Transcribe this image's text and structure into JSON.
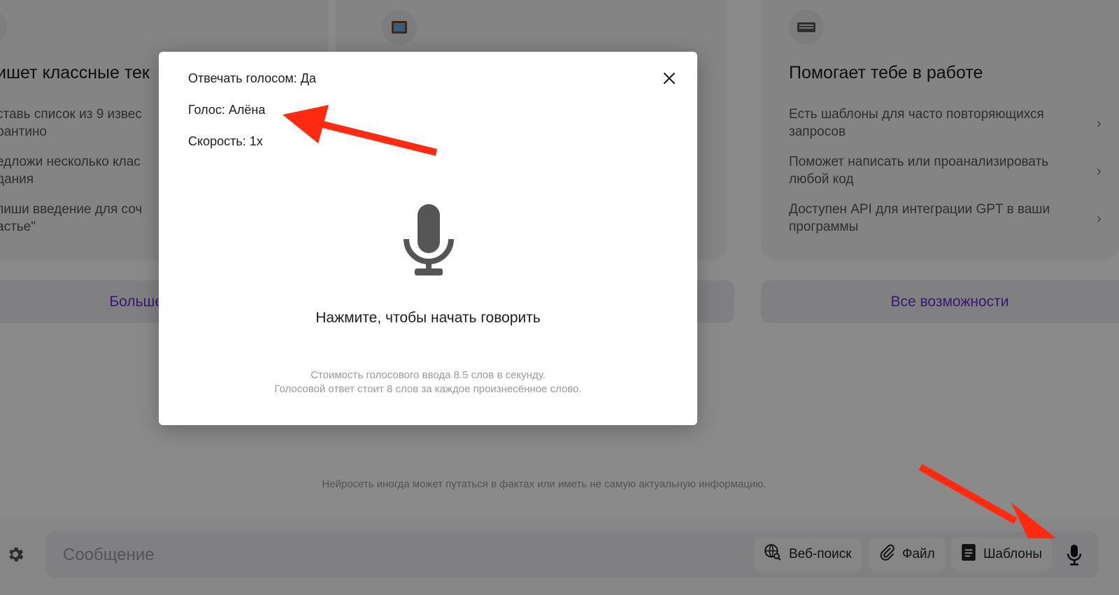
{
  "columns": [
    {
      "icon": "pencil-icon",
      "title": "ишет классные тек",
      "items": [
        "ставь список из 9 извес\nрантино",
        "едложи несколько клас\nдания",
        "пиши введение для соч\nастье\""
      ],
      "more_label": "Больше при"
    },
    {
      "icon": "picture-icon",
      "title": "",
      "items": [],
      "more_label": ""
    },
    {
      "icon": "keyboard-icon",
      "title": "Помогает тебе в работе",
      "items": [
        "Есть шаблоны для часто повторяющихся\nзапросов",
        "Поможет написать или проанализировать\nлюбой код",
        "Доступен API для интеграции GPT в ваши\nпрограммы"
      ],
      "more_label": "Все возможности"
    }
  ],
  "disclaimer": "Нейросеть иногда может путаться в фактах или иметь не самую актуальную информацию.",
  "composer": {
    "placeholder": "Сообщение",
    "buttons": {
      "web_search": "Веб-поиск",
      "file": "Файл",
      "templates": "Шаблоны"
    }
  },
  "modal": {
    "reply_by_voice": "Отвечать голосом: Да",
    "voice": "Голос: Алёна",
    "speed": "Скорость: 1x",
    "prompt": "Нажмите, чтобы начать говорить",
    "cost_input": "Стоимость голосового ввода 8.5 слов в секунду.",
    "cost_output": "Голосовой ответ стоит 8 слов за каждое произнесённое слово."
  },
  "colors": {
    "accent": "#6a2bd6",
    "arrow": "#ff2a0f",
    "overlay": "#000000"
  }
}
